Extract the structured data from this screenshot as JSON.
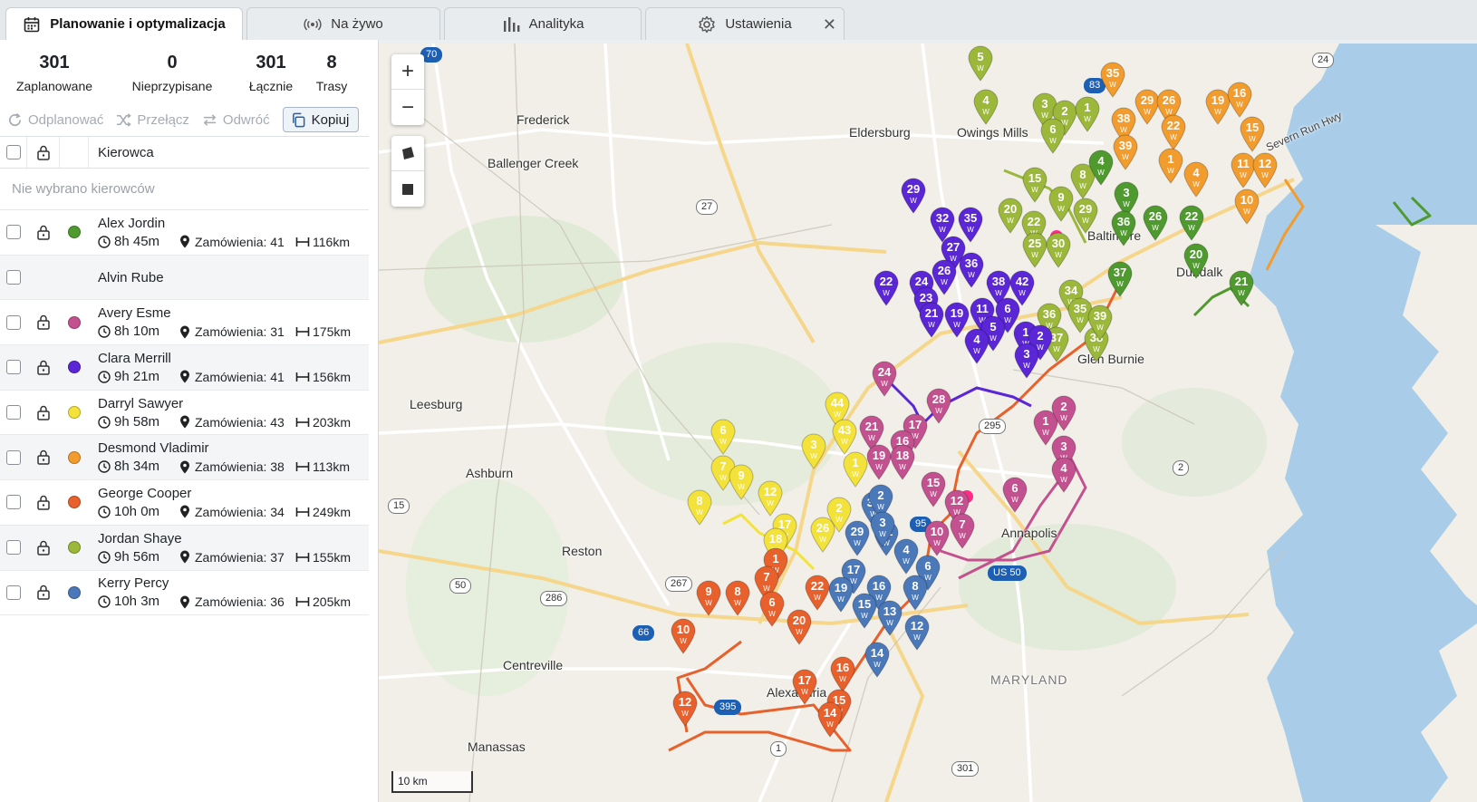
{
  "tabs": [
    {
      "label": "Planowanie i optymalizacja",
      "icon": "calendar-icon",
      "active": true
    },
    {
      "label": "Na żywo",
      "icon": "broadcast-icon",
      "active": false
    },
    {
      "label": "Analityka",
      "icon": "bar-chart-icon",
      "active": false
    },
    {
      "label": "Ustawienia",
      "icon": "gear-icon",
      "active": false
    }
  ],
  "tab_close": "✕",
  "stats": [
    {
      "value": "301",
      "label": "Zaplanowane"
    },
    {
      "value": "0",
      "label": "Nieprzypisane"
    },
    {
      "value": "301",
      "label": "Łącznie"
    },
    {
      "value": "8",
      "label": "Trasy"
    }
  ],
  "toolbar": {
    "unplan": "Odplanować",
    "switch": "Przełącz",
    "reverse": "Odwróć",
    "copy": "Kopiuj"
  },
  "table": {
    "header": "Kierowca",
    "empty": "Nie wybrano kierowców"
  },
  "drivers": [
    {
      "name": "Alex Jordin",
      "color": "#4f9a2e",
      "time": "8h 45m",
      "orders": "Zamówienia: 41",
      "distance": "116km",
      "has_details": true
    },
    {
      "name": "Alvin Rube",
      "color": "",
      "time": "",
      "orders": "",
      "distance": "",
      "has_details": false
    },
    {
      "name": "Avery Esme",
      "color": "#c4518f",
      "time": "8h 10m",
      "orders": "Zamówienia: 31",
      "distance": "175km",
      "has_details": true
    },
    {
      "name": "Clara Merrill",
      "color": "#5a26d6",
      "time": "9h 21m",
      "orders": "Zamówienia: 41",
      "distance": "156km",
      "has_details": true
    },
    {
      "name": "Darryl Sawyer",
      "color": "#f2e23a",
      "time": "9h 58m",
      "orders": "Zamówienia: 43",
      "distance": "203km",
      "has_details": true
    },
    {
      "name": "Desmond Vladimir",
      "color": "#f29c2e",
      "time": "8h 34m",
      "orders": "Zamówienia: 38",
      "distance": "113km",
      "has_details": true
    },
    {
      "name": "George Cooper",
      "color": "#e8612c",
      "time": "10h 0m",
      "orders": "Zamówienia: 34",
      "distance": "249km",
      "has_details": true
    },
    {
      "name": "Jordan Shaye",
      "color": "#9bb83a",
      "time": "9h 56m",
      "orders": "Zamówienia: 37",
      "distance": "155km",
      "has_details": true
    },
    {
      "name": "Kerry Percy",
      "color": "#4a78b8",
      "time": "10h 3m",
      "orders": "Zamówienia: 36",
      "distance": "205km",
      "has_details": true
    }
  ],
  "map": {
    "zoom_in": "+",
    "zoom_out": "−",
    "scale": "10 km",
    "places": [
      "Frederick",
      "Eldersburg",
      "Owings Mills",
      "Ballenger Creek",
      "Baltimore",
      "Dundalk",
      "Glen Burnie",
      "Leesburg",
      "Ashburn",
      "Reston",
      "Centreville",
      "Alexandria",
      "Annapolis",
      "MARYLAND",
      "Manassas",
      "Severn Run Hwy"
    ],
    "shields": [
      "70",
      "83",
      "24",
      "27",
      "295",
      "2",
      "15",
      "95",
      "US 50",
      "50",
      "267",
      "286",
      "66",
      "395",
      "1",
      "301"
    ],
    "pins": [
      {
        "n": "5",
        "c": "#9bb83a"
      },
      {
        "n": "4",
        "c": "#9bb83a"
      },
      {
        "n": "3",
        "c": "#9bb83a"
      },
      {
        "n": "2",
        "c": "#9bb83a"
      },
      {
        "n": "1",
        "c": "#9bb83a"
      },
      {
        "n": "6",
        "c": "#9bb83a"
      },
      {
        "n": "8",
        "c": "#9bb83a"
      },
      {
        "n": "9",
        "c": "#9bb83a"
      },
      {
        "n": "15",
        "c": "#9bb83a"
      },
      {
        "n": "20",
        "c": "#9bb83a"
      },
      {
        "n": "22",
        "c": "#9bb83a"
      },
      {
        "n": "25",
        "c": "#9bb83a"
      },
      {
        "n": "30",
        "c": "#9bb83a"
      },
      {
        "n": "29",
        "c": "#9bb83a"
      },
      {
        "n": "34",
        "c": "#9bb83a"
      },
      {
        "n": "36",
        "c": "#9bb83a"
      },
      {
        "n": "37",
        "c": "#9bb83a"
      },
      {
        "n": "35",
        "c": "#9bb83a"
      },
      {
        "n": "38",
        "c": "#9bb83a"
      },
      {
        "n": "39",
        "c": "#9bb83a"
      },
      {
        "n": "35",
        "c": "#f29c2e"
      },
      {
        "n": "29",
        "c": "#f29c2e"
      },
      {
        "n": "26",
        "c": "#f29c2e"
      },
      {
        "n": "19",
        "c": "#f29c2e"
      },
      {
        "n": "16",
        "c": "#f29c2e"
      },
      {
        "n": "38",
        "c": "#f29c2e"
      },
      {
        "n": "22",
        "c": "#f29c2e"
      },
      {
        "n": "15",
        "c": "#f29c2e"
      },
      {
        "n": "39",
        "c": "#f29c2e"
      },
      {
        "n": "1",
        "c": "#f29c2e"
      },
      {
        "n": "4",
        "c": "#f29c2e"
      },
      {
        "n": "11",
        "c": "#f29c2e"
      },
      {
        "n": "12",
        "c": "#f29c2e"
      },
      {
        "n": "10",
        "c": "#f29c2e"
      },
      {
        "n": "4",
        "c": "#4f9a2e"
      },
      {
        "n": "3",
        "c": "#4f9a2e"
      },
      {
        "n": "36",
        "c": "#4f9a2e"
      },
      {
        "n": "26",
        "c": "#4f9a2e"
      },
      {
        "n": "22",
        "c": "#4f9a2e"
      },
      {
        "n": "20",
        "c": "#4f9a2e"
      },
      {
        "n": "37",
        "c": "#4f9a2e"
      },
      {
        "n": "21",
        "c": "#4f9a2e"
      },
      {
        "n": "29",
        "c": "#5a26d6"
      },
      {
        "n": "32",
        "c": "#5a26d6"
      },
      {
        "n": "35",
        "c": "#5a26d6"
      },
      {
        "n": "27",
        "c": "#5a26d6"
      },
      {
        "n": "36",
        "c": "#5a26d6"
      },
      {
        "n": "22",
        "c": "#5a26d6"
      },
      {
        "n": "24",
        "c": "#5a26d6"
      },
      {
        "n": "26",
        "c": "#5a26d6"
      },
      {
        "n": "23",
        "c": "#5a26d6"
      },
      {
        "n": "38",
        "c": "#5a26d6"
      },
      {
        "n": "42",
        "c": "#5a26d6"
      },
      {
        "n": "21",
        "c": "#5a26d6"
      },
      {
        "n": "19",
        "c": "#5a26d6"
      },
      {
        "n": "11",
        "c": "#5a26d6"
      },
      {
        "n": "6",
        "c": "#5a26d6"
      },
      {
        "n": "5",
        "c": "#5a26d6"
      },
      {
        "n": "4",
        "c": "#5a26d6"
      },
      {
        "n": "1",
        "c": "#5a26d6"
      },
      {
        "n": "2",
        "c": "#5a26d6"
      },
      {
        "n": "3",
        "c": "#5a26d6"
      },
      {
        "n": "24",
        "c": "#c4518f"
      },
      {
        "n": "28",
        "c": "#c4518f"
      },
      {
        "n": "21",
        "c": "#c4518f"
      },
      {
        "n": "17",
        "c": "#c4518f"
      },
      {
        "n": "16",
        "c": "#c4518f"
      },
      {
        "n": "19",
        "c": "#c4518f"
      },
      {
        "n": "18",
        "c": "#c4518f"
      },
      {
        "n": "15",
        "c": "#c4518f"
      },
      {
        "n": "12",
        "c": "#c4518f"
      },
      {
        "n": "10",
        "c": "#c4518f"
      },
      {
        "n": "7",
        "c": "#c4518f"
      },
      {
        "n": "6",
        "c": "#c4518f"
      },
      {
        "n": "1",
        "c": "#c4518f"
      },
      {
        "n": "2",
        "c": "#c4518f"
      },
      {
        "n": "3",
        "c": "#c4518f"
      },
      {
        "n": "4",
        "c": "#c4518f"
      },
      {
        "n": "6",
        "c": "#f2e23a"
      },
      {
        "n": "7",
        "c": "#f2e23a"
      },
      {
        "n": "9",
        "c": "#f2e23a"
      },
      {
        "n": "8",
        "c": "#f2e23a"
      },
      {
        "n": "12",
        "c": "#f2e23a"
      },
      {
        "n": "17",
        "c": "#f2e23a"
      },
      {
        "n": "18",
        "c": "#f2e23a"
      },
      {
        "n": "44",
        "c": "#f2e23a"
      },
      {
        "n": "43",
        "c": "#f2e23a"
      },
      {
        "n": "3",
        "c": "#f2e23a"
      },
      {
        "n": "1",
        "c": "#f2e23a"
      },
      {
        "n": "26",
        "c": "#f2e23a"
      },
      {
        "n": "2",
        "c": "#f2e23a"
      },
      {
        "n": "36",
        "c": "#4a78b8"
      },
      {
        "n": "31",
        "c": "#4a78b8"
      },
      {
        "n": "29",
        "c": "#4a78b8"
      },
      {
        "n": "2",
        "c": "#4a78b8"
      },
      {
        "n": "3",
        "c": "#4a78b8"
      },
      {
        "n": "4",
        "c": "#4a78b8"
      },
      {
        "n": "6",
        "c": "#4a78b8"
      },
      {
        "n": "17",
        "c": "#4a78b8"
      },
      {
        "n": "19",
        "c": "#4a78b8"
      },
      {
        "n": "16",
        "c": "#4a78b8"
      },
      {
        "n": "8",
        "c": "#4a78b8"
      },
      {
        "n": "15",
        "c": "#4a78b8"
      },
      {
        "n": "13",
        "c": "#4a78b8"
      },
      {
        "n": "12",
        "c": "#4a78b8"
      },
      {
        "n": "14",
        "c": "#4a78b8"
      },
      {
        "n": "1",
        "c": "#e8612c"
      },
      {
        "n": "7",
        "c": "#e8612c"
      },
      {
        "n": "22",
        "c": "#e8612c"
      },
      {
        "n": "9",
        "c": "#e8612c"
      },
      {
        "n": "8",
        "c": "#e8612c"
      },
      {
        "n": "6",
        "c": "#e8612c"
      },
      {
        "n": "20",
        "c": "#e8612c"
      },
      {
        "n": "10",
        "c": "#e8612c"
      },
      {
        "n": "12",
        "c": "#e8612c"
      },
      {
        "n": "17",
        "c": "#e8612c"
      },
      {
        "n": "16",
        "c": "#e8612c"
      },
      {
        "n": "15",
        "c": "#e8612c"
      },
      {
        "n": "14",
        "c": "#e8612c"
      }
    ]
  }
}
